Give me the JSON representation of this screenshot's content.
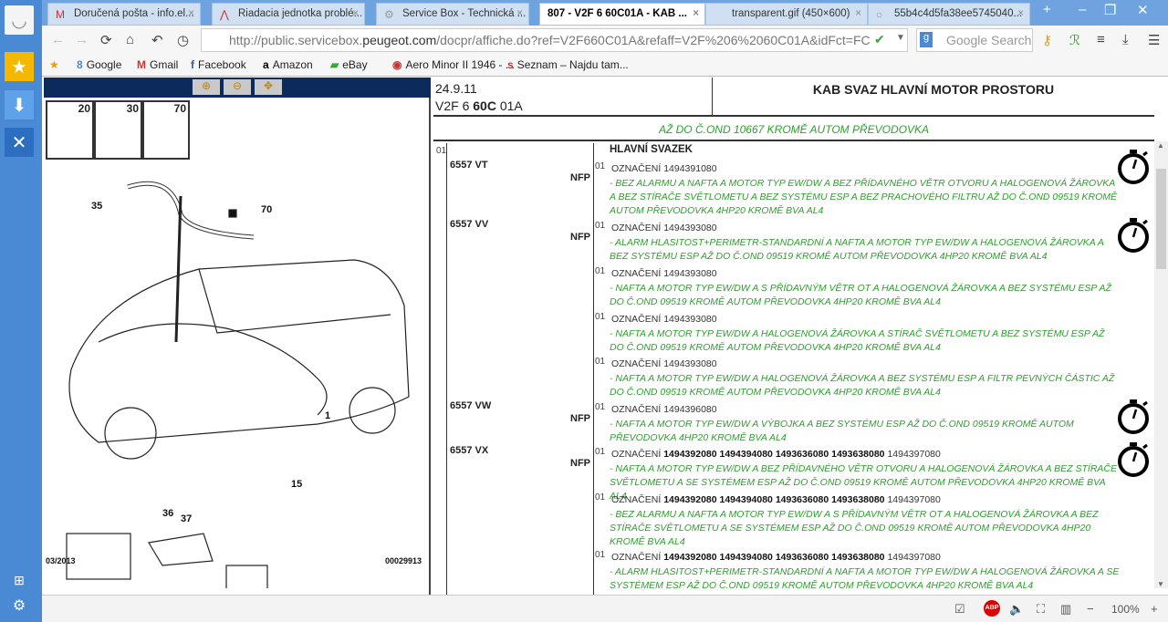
{
  "browser": {
    "tabs": [
      {
        "label": "Doručená pošta - info.el...",
        "icon": "gmail-icon"
      },
      {
        "label": "Riadacia jednotka problé...",
        "icon": "citroen-icon"
      },
      {
        "label": "Service Box - Technická ...",
        "icon": "servicebox-icon"
      },
      {
        "label": "807 - V2F 6 60C01A - KAB ...",
        "active": true
      },
      {
        "label": "transparent.gif (450×600)"
      },
      {
        "label": "55b4c4d5fa38ee5745040...",
        "icon": "page-icon"
      }
    ],
    "url_prefix": "http://public.servicebox.",
    "url_domain": "peugeot.com",
    "url_rest": "/docpr/affiche.do?ref=V2F660C01A&refaff=V2F%206%2060C01A&idFct=FC",
    "search_placeholder": "Google Search",
    "bookmarks": [
      "Google",
      "Gmail",
      "Facebook",
      "Amazon",
      "eBay",
      "Aero Minor II 1946 - ...",
      "Seznam – Najdu tam..."
    ],
    "zoom": "100%"
  },
  "diagram": {
    "thumbs": [
      "20",
      "30",
      "70"
    ],
    "labels": {
      "l35": "35",
      "l70": "70",
      "l1": "1",
      "l36": "36",
      "l37": "37",
      "l15": "15"
    },
    "date": "03/2013",
    "ref": "00029913"
  },
  "doc": {
    "date": "24.9.11",
    "code_a": "V2F 6 ",
    "code_b": "60C",
    "code_c": " 01A",
    "title": "KAB SVAZ HLAVNÍ MOTOR PROSTORU",
    "subtitle": "AŽ DO Č.OND 10667 KROMĚ AUTOM PŘEVODOVKA",
    "group_no": "01",
    "group_title": "HLAVNÍ SVAZEK",
    "entries": [
      {
        "part": "6557 VT",
        "nfp": "NFP",
        "qty": "01",
        "label": "OZNAČENÍ",
        "bold_refs": "",
        "ref": "1494391080",
        "desc": "- BEZ ALARMU A NAFTA A MOTOR TYP EW/DW A BEZ PŘÍDAVNÉHO VĚTR OTVORU A HALOGENOVÁ ŽÁROVKA A BEZ STÍRAČE SVĚTLOMETU A BEZ SYSTÉMU ESP A BEZ PRACHOVÉHO FILTRU AŽ DO Č.OND 09519 KROMĚ AUTOM PŘEVODOVKA 4HP20 KROMĚ BVA AL4",
        "timer": true
      },
      {
        "part": "6557 VV",
        "nfp": "NFP",
        "qty": "01",
        "label": "OZNAČENÍ",
        "bold_refs": "",
        "ref": "1494393080",
        "desc": "- ALARM HLASITOST+PERIMETR-STANDARDNÍ A NAFTA A MOTOR TYP EW/DW A HALOGENOVÁ ŽÁROVKA A BEZ SYSTÉMU ESP AŽ DO Č.OND 09519 KROMĚ AUTOM PŘEVODOVKA 4HP20 KROMĚ BVA AL4",
        "timer": true
      },
      {
        "part": "",
        "nfp": "",
        "qty": "01",
        "label": "OZNAČENÍ",
        "bold_refs": "",
        "ref": "1494393080",
        "desc": "- NAFTA A MOTOR TYP EW/DW A S PŘÍDAVNÝM VĚTR OT A HALOGENOVÁ ŽÁROVKA A BEZ SYSTÉMU ESP AŽ DO Č.OND 09519 KROMĚ AUTOM PŘEVODOVKA 4HP20 KROMĚ BVA AL4",
        "timer": false
      },
      {
        "part": "",
        "nfp": "",
        "qty": "01",
        "label": "OZNAČENÍ",
        "bold_refs": "",
        "ref": "1494393080",
        "desc": "- NAFTA A MOTOR TYP EW/DW A HALOGENOVÁ ŽÁROVKA A STÍRAČ SVĚTLOMETU A BEZ SYSTÉMU ESP AŽ DO Č.OND 09519 KROMĚ AUTOM PŘEVODOVKA 4HP20 KROMĚ BVA AL4",
        "timer": false
      },
      {
        "part": "",
        "nfp": "",
        "qty": "01",
        "label": "OZNAČENÍ",
        "bold_refs": "",
        "ref": "1494393080",
        "desc": "- NAFTA A MOTOR TYP EW/DW A HALOGENOVÁ ŽÁROVKA A BEZ SYSTÉMU ESP A FILTR PEVNÝCH ČÁSTIC AŽ DO Č.OND 09519 KROMĚ AUTOM PŘEVODOVKA 4HP20 KROMĚ BVA AL4",
        "timer": false
      },
      {
        "part": "6557 VW",
        "nfp": "NFP",
        "qty": "01",
        "label": "OZNAČENÍ",
        "bold_refs": "",
        "ref": "1494396080",
        "desc": "- NAFTA A MOTOR TYP EW/DW A VÝBOJKA A BEZ SYSTÉMU ESP AŽ DO Č.OND 09519 KROMĚ AUTOM PŘEVODOVKA 4HP20 KROMĚ BVA AL4",
        "timer": true
      },
      {
        "part": "6557 VX",
        "nfp": "NFP",
        "qty": "01",
        "label": "OZNAČENÍ",
        "bold_refs": "1494392080 1494394080 1493636080 1493638080",
        "ref": "1494397080",
        "desc": "- NAFTA A MOTOR TYP EW/DW A BEZ PŘÍDAVNÉHO VĚTR OTVORU A HALOGENOVÁ ŽÁROVKA A BEZ STÍRAČE SVĚTLOMETU A SE SYSTÉMEM ESP AŽ DO Č.OND 09519 KROMĚ AUTOM PŘEVODOVKA 4HP20 KROMĚ BVA AL4",
        "timer": true
      },
      {
        "part": "",
        "nfp": "",
        "qty": "01",
        "label": "OZNAČENÍ",
        "bold_refs": "1494392080 1494394080 1493636080 1493638080",
        "ref": "1494397080",
        "desc": "- BEZ ALARMU A NAFTA A MOTOR TYP EW/DW A S PŘÍDAVNÝM VĚTR OT A HALOGENOVÁ ŽÁROVKA A BEZ STÍRAČE SVĚTLOMETU A SE SYSTÉMEM ESP AŽ DO Č.OND 09519 KROMĚ AUTOM PŘEVODOVKA 4HP20 KROMĚ BVA AL4",
        "timer": false
      },
      {
        "part": "",
        "nfp": "",
        "qty": "01",
        "label": "OZNAČENÍ",
        "bold_refs": "1494392080 1494394080 1493636080 1493638080",
        "ref": "1494397080",
        "desc": "- ALARM HLASITOST+PERIMETR-STANDARDNÍ A NAFTA A MOTOR TYP EW/DW A HALOGENOVÁ ŽÁROVKA A SE SYSTÉMEM ESP AŽ DO Č.OND 09519 KROMĚ AUTOM PŘEVODOVKA 4HP20 KROMĚ BVA AL4",
        "timer": false
      }
    ]
  },
  "colors": {
    "green": "#2e9e2e",
    "navy": "#0d2a5c",
    "sidebar": "#4a8ad4"
  }
}
